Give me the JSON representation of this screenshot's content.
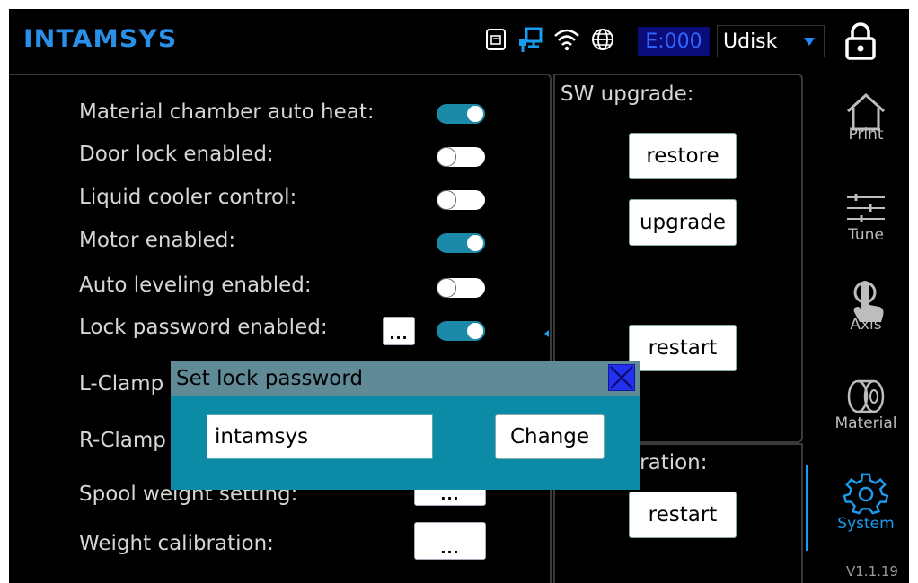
{
  "header": {
    "logo": "INTAMSYS",
    "error_code": "E:000",
    "storage_select": "Udisk"
  },
  "settings": {
    "rows": [
      {
        "label": "Material chamber auto heat:",
        "state": "on"
      },
      {
        "label": "Door lock enabled:",
        "state": "off"
      },
      {
        "label": "Liquid cooler control:",
        "state": "off"
      },
      {
        "label": "Motor enabled:",
        "state": "on"
      },
      {
        "label": "Auto leveling enabled:",
        "state": "off"
      },
      {
        "label": "Lock password enabled:",
        "state": "on"
      }
    ],
    "lclamp_label": "L-Clamp",
    "rclamp_label": "R-Clamp",
    "spool_label": "Spool weight setting:",
    "weight_label": "Weight calibration:",
    "dots": "..."
  },
  "sw_upgrade": {
    "title": "SW upgrade:",
    "restore": "restore",
    "upgrade": "upgrade",
    "restart": "restart"
  },
  "operation": {
    "title_partial": "eration:",
    "restart": "restart"
  },
  "nav": {
    "print": "Print",
    "tune": "Tune",
    "axis": "Axis",
    "material": "Material",
    "system": "System",
    "version": "V1.1.19"
  },
  "dialog": {
    "title": "Set lock password",
    "input_value": "intamsys",
    "change": "Change"
  },
  "colors": {
    "accent": "#1a9cf0",
    "toggle_on": "#1b8aa8",
    "dialog_bg": "#0b8ba6",
    "dialog_title_bg": "#5f8a96"
  }
}
